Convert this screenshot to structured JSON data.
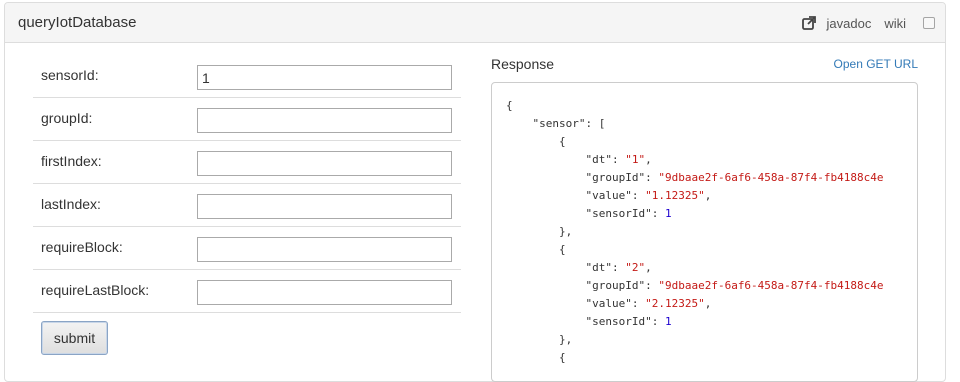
{
  "header": {
    "title": "queryIotDatabase",
    "javadoc_label": "javadoc",
    "wiki_label": "wiki"
  },
  "form": {
    "fields": [
      {
        "label": "sensorId:",
        "value": "1"
      },
      {
        "label": "groupId:",
        "value": ""
      },
      {
        "label": "firstIndex:",
        "value": ""
      },
      {
        "label": "lastIndex:",
        "value": ""
      },
      {
        "label": "requireBlock:",
        "value": ""
      },
      {
        "label": "requireLastBlock:",
        "value": ""
      }
    ],
    "submit_label": "submit"
  },
  "response": {
    "label": "Response",
    "open_url_label": "Open GET URL",
    "lines": [
      [
        {
          "t": "{",
          "c": "p"
        }
      ],
      [
        {
          "t": "    ",
          "c": "p"
        },
        {
          "t": "\"sensor\"",
          "c": "p"
        },
        {
          "t": ": [",
          "c": "p"
        }
      ],
      [
        {
          "t": "        {",
          "c": "p"
        }
      ],
      [
        {
          "t": "            ",
          "c": "p"
        },
        {
          "t": "\"dt\"",
          "c": "p"
        },
        {
          "t": ": ",
          "c": "p"
        },
        {
          "t": "\"1\"",
          "c": "s"
        },
        {
          "t": ",",
          "c": "p"
        }
      ],
      [
        {
          "t": "            ",
          "c": "p"
        },
        {
          "t": "\"groupId\"",
          "c": "p"
        },
        {
          "t": ": ",
          "c": "p"
        },
        {
          "t": "\"9dbaae2f-6af6-458a-87f4-fb4188c4e",
          "c": "s"
        }
      ],
      [
        {
          "t": "            ",
          "c": "p"
        },
        {
          "t": "\"value\"",
          "c": "p"
        },
        {
          "t": ": ",
          "c": "p"
        },
        {
          "t": "\"1.12325\"",
          "c": "s"
        },
        {
          "t": ",",
          "c": "p"
        }
      ],
      [
        {
          "t": "            ",
          "c": "p"
        },
        {
          "t": "\"sensorId\"",
          "c": "p"
        },
        {
          "t": ": ",
          "c": "p"
        },
        {
          "t": "1",
          "c": "n"
        }
      ],
      [
        {
          "t": "        },",
          "c": "p"
        }
      ],
      [
        {
          "t": "        {",
          "c": "p"
        }
      ],
      [
        {
          "t": "            ",
          "c": "p"
        },
        {
          "t": "\"dt\"",
          "c": "p"
        },
        {
          "t": ": ",
          "c": "p"
        },
        {
          "t": "\"2\"",
          "c": "s"
        },
        {
          "t": ",",
          "c": "p"
        }
      ],
      [
        {
          "t": "            ",
          "c": "p"
        },
        {
          "t": "\"groupId\"",
          "c": "p"
        },
        {
          "t": ": ",
          "c": "p"
        },
        {
          "t": "\"9dbaae2f-6af6-458a-87f4-fb4188c4e",
          "c": "s"
        }
      ],
      [
        {
          "t": "            ",
          "c": "p"
        },
        {
          "t": "\"value\"",
          "c": "p"
        },
        {
          "t": ": ",
          "c": "p"
        },
        {
          "t": "\"2.12325\"",
          "c": "s"
        },
        {
          "t": ",",
          "c": "p"
        }
      ],
      [
        {
          "t": "            ",
          "c": "p"
        },
        {
          "t": "\"sensorId\"",
          "c": "p"
        },
        {
          "t": ": ",
          "c": "p"
        },
        {
          "t": "1",
          "c": "n"
        }
      ],
      [
        {
          "t": "        },",
          "c": "p"
        }
      ],
      [
        {
          "t": "        {",
          "c": "p"
        }
      ]
    ]
  },
  "icons": {
    "external": "external-link-icon",
    "checkbox": "checkbox-icon"
  },
  "colors": {
    "link": "#337ab7",
    "json_string": "#c41a16",
    "json_number": "#1c00cf"
  }
}
